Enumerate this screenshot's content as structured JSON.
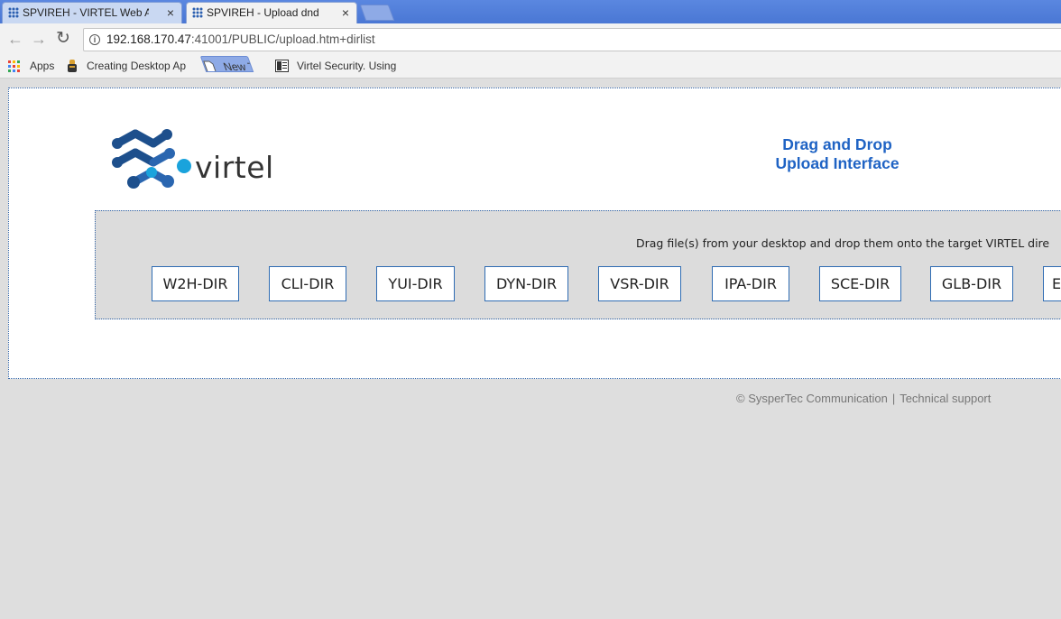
{
  "browser": {
    "tabs": [
      {
        "title": "SPVIREH - VIRTEL Web A",
        "active": false
      },
      {
        "title": "SPVIREH - Upload dnd",
        "active": true
      }
    ],
    "close_glyph": "×",
    "address": {
      "host": "192.168.170.47",
      "rest": ":41001/PUBLIC/upload.htm+dirlist"
    },
    "bookmarks": [
      {
        "label": "Apps",
        "icon": "apps-grid-icon"
      },
      {
        "label": "Creating Desktop Ap",
        "icon": "extension-icon"
      },
      {
        "label": "New Tab",
        "icon": "page-icon"
      },
      {
        "label": "Virtel Security. Using",
        "icon": "book-icon"
      }
    ]
  },
  "page": {
    "logo_text": "virtel",
    "heading_line1": "Drag and Drop",
    "heading_line2": "Upload Interface",
    "instruction": "Drag file(s) from your desktop and drop them onto the target VIRTEL dire",
    "directories": [
      "W2H-DIR",
      "CLI-DIR",
      "YUI-DIR",
      "DYN-DIR",
      "VSR-DIR",
      "IPA-DIR",
      "SCE-DIR",
      "GLB-DIR",
      "E"
    ],
    "footer": {
      "company": "© SysperTec Communication",
      "separator": "|",
      "support": "Technical support"
    }
  },
  "colors": {
    "tabstrip": "#4a77d4",
    "heading": "#1f63c4",
    "dir_border": "#2f6cb3",
    "logo_dark": "#1d4f8c",
    "logo_light": "#1aa3dc"
  }
}
